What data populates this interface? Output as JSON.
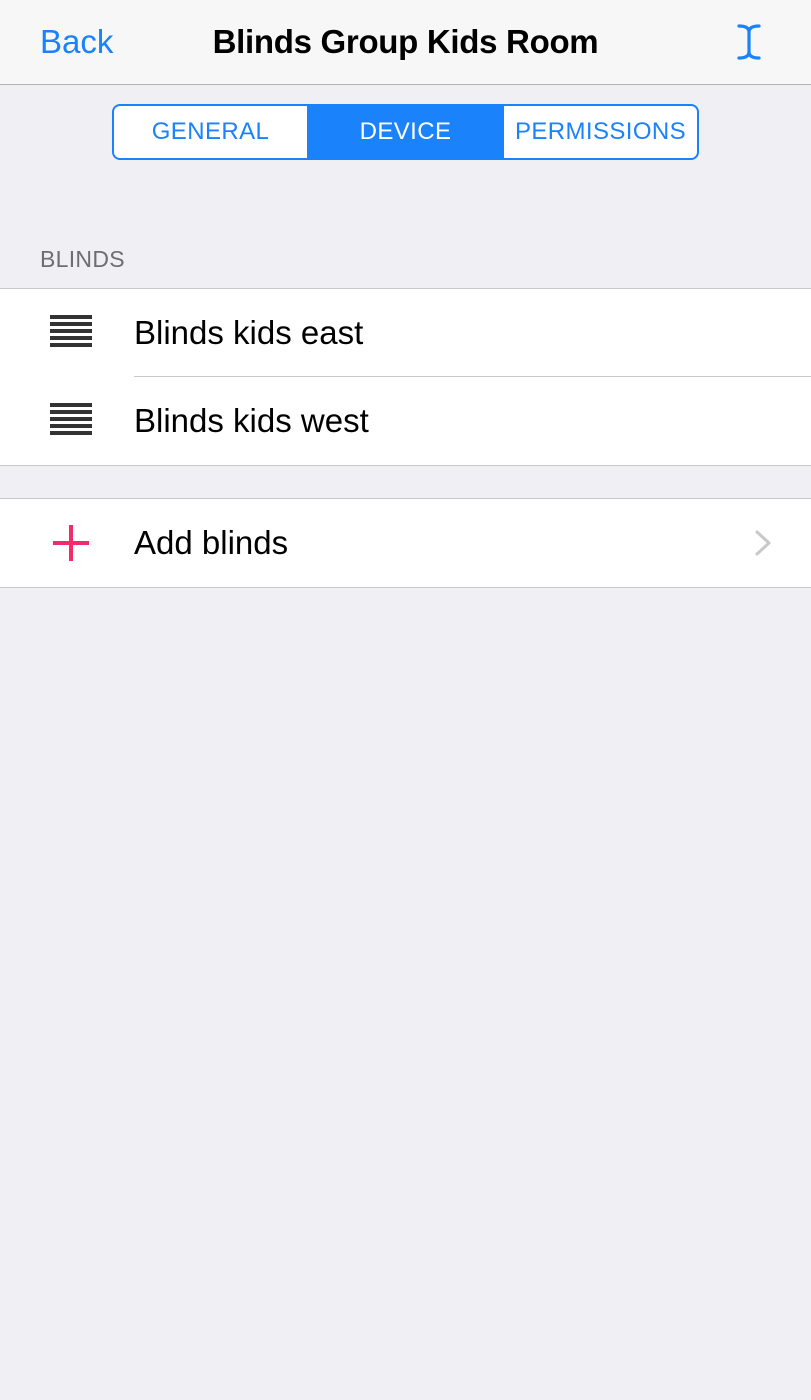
{
  "navbar": {
    "back_label": "Back",
    "title": "Blinds Group Kids Room",
    "edit_icon": "text-cursor-icon"
  },
  "tabs": [
    {
      "label": "GENERAL",
      "active": false
    },
    {
      "label": "DEVICE",
      "active": true
    },
    {
      "label": "PERMISSIONS",
      "active": false
    }
  ],
  "blinds_section": {
    "header": "BLINDS",
    "items": [
      {
        "label": "Blinds kids east",
        "icon": "blinds-icon"
      },
      {
        "label": "Blinds kids west",
        "icon": "blinds-icon"
      }
    ]
  },
  "add_row": {
    "label": "Add blinds",
    "icon": "plus-icon",
    "accessory": "chevron-right-icon"
  },
  "colors": {
    "accent": "#1a82fb",
    "add_icon": "#ef2d6a",
    "background": "#efeff4"
  }
}
